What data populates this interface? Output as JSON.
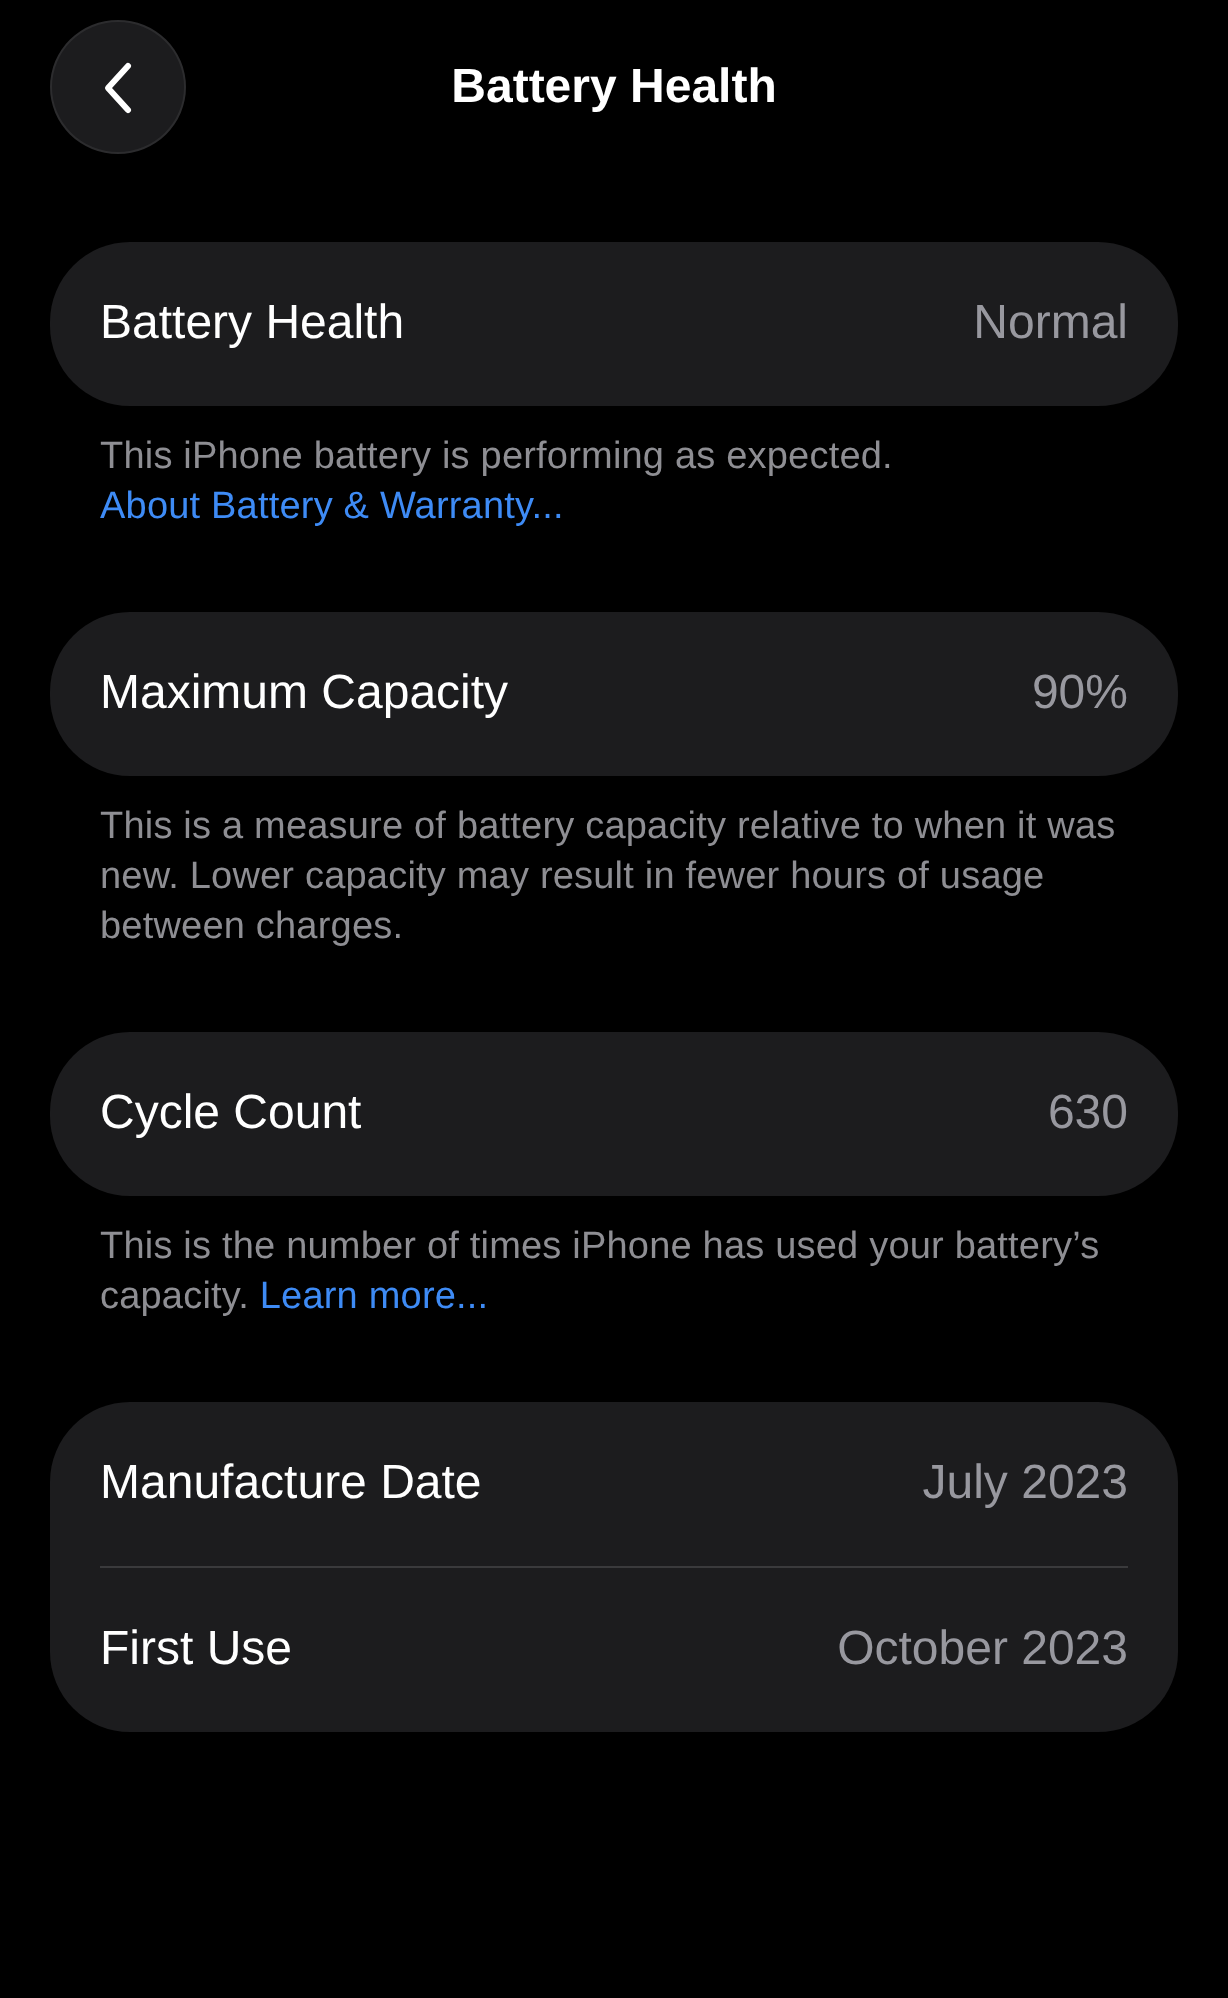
{
  "nav": {
    "title": "Battery Health"
  },
  "sections": [
    {
      "rows": [
        {
          "label": "Battery Health",
          "value": "Normal"
        }
      ],
      "footer": "This iPhone battery is performing as expected.",
      "link": "About Battery & Warranty..."
    },
    {
      "rows": [
        {
          "label": "Maximum Capacity",
          "value": "90%"
        }
      ],
      "footer": "This is a measure of battery capacity relative to when it was new. Lower capacity may result in fewer hours of usage between charges."
    },
    {
      "rows": [
        {
          "label": "Cycle Count",
          "value": "630"
        }
      ],
      "footer": "This is the number of times iPhone has used your battery’s capacity.",
      "link": "Learn more..."
    },
    {
      "rows": [
        {
          "label": "Manufacture Date",
          "value": "July 2023"
        },
        {
          "label": "First Use",
          "value": "October 2023"
        }
      ]
    }
  ]
}
